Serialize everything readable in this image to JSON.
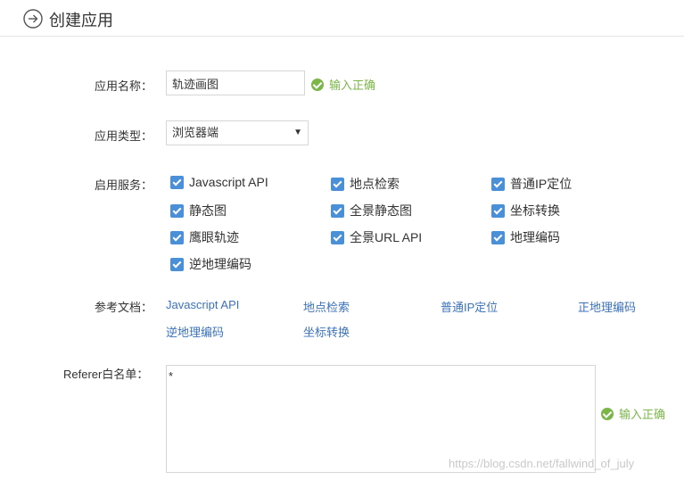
{
  "header": {
    "title": "创建应用",
    "icon": "arrow-circle-right-icon"
  },
  "form": {
    "app_name": {
      "label": "应用名称：",
      "value": "轨迹画图",
      "validation": "输入正确"
    },
    "app_type": {
      "label": "应用类型：",
      "selected": "浏览器端"
    },
    "services": {
      "label": "启用服务：",
      "items": [
        {
          "label": "Javascript API",
          "checked": true
        },
        {
          "label": "地点检索",
          "checked": true
        },
        {
          "label": "普通IP定位",
          "checked": true
        },
        {
          "label": "静态图",
          "checked": true
        },
        {
          "label": "全景静态图",
          "checked": true
        },
        {
          "label": "坐标转换",
          "checked": true
        },
        {
          "label": "鹰眼轨迹",
          "checked": true
        },
        {
          "label": "全景URL API",
          "checked": true
        },
        {
          "label": "地理编码",
          "checked": true
        },
        {
          "label": "逆地理编码",
          "checked": true
        }
      ]
    },
    "docs": {
      "label": "参考文档：",
      "links": [
        "Javascript API",
        "地点检索",
        "普通IP定位",
        "正地理编码",
        "逆地理编码",
        "坐标转换"
      ]
    },
    "referer": {
      "label": "Referer白名单：",
      "value": "*",
      "validation": "输入正确"
    }
  },
  "watermark": "https://blog.csdn.net/fallwind_of_july",
  "colors": {
    "accent": "#4a90d9",
    "valid": "#7ab648",
    "link": "#3b72b9"
  }
}
